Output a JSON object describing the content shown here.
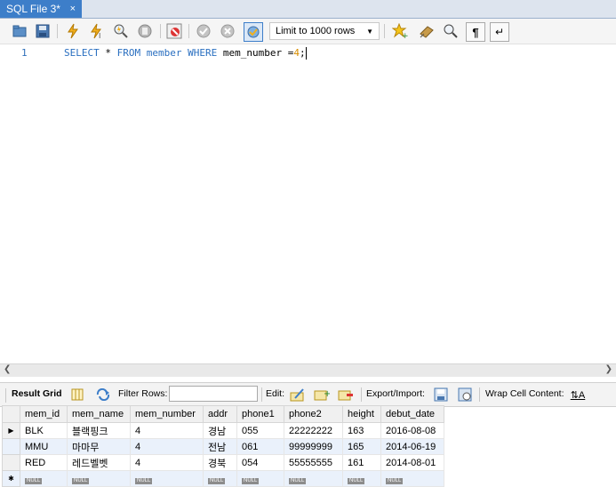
{
  "tab": {
    "title": "SQL File 3*",
    "close": "×"
  },
  "toolbar": {
    "limit_select": "Limit to 1000 rows",
    "icons": [
      "open-folder-icon",
      "save-icon",
      "execute-icon",
      "execute-current-icon",
      "explain-icon",
      "stop-icon",
      "toggle-error-icon",
      "commit-icon",
      "rollback-icon",
      "autocommit-icon",
      "bookmark-icon",
      "beautify-icon",
      "find-icon",
      "invisible-chars-icon",
      "wrap-icon"
    ]
  },
  "editor": {
    "line_number": "1",
    "tokens": {
      "select": "SELECT",
      "star": " * ",
      "from": "FROM",
      "table": " member ",
      "where": "WHERE",
      "cond": " mem_number =",
      "value": "4",
      "end": ";"
    }
  },
  "result_toolbar": {
    "result_grid": "Result Grid",
    "filter_rows": "Filter Rows:",
    "filter_value": "",
    "edit": "Edit:",
    "export_import": "Export/Import:",
    "wrap_cell": "Wrap Cell Content:"
  },
  "grid": {
    "columns": [
      "mem_id",
      "mem_name",
      "mem_number",
      "addr",
      "phone1",
      "phone2",
      "height",
      "debut_date"
    ],
    "rows": [
      [
        "BLK",
        "블랙핑크",
        "4",
        "경남",
        "055",
        "22222222",
        "163",
        "2016-08-08"
      ],
      [
        "MMU",
        "마마무",
        "4",
        "전남",
        "061",
        "99999999",
        "165",
        "2014-06-19"
      ],
      [
        "RED",
        "레드벨벳",
        "4",
        "경북",
        "054",
        "55555555",
        "161",
        "2014-08-01"
      ]
    ],
    "null_label": "NULL"
  },
  "colors": {
    "tab_active": "#3d7ec9",
    "keyword": "#2a6fc0",
    "number": "#d78d00",
    "row_alt": "#eaf1fb"
  }
}
